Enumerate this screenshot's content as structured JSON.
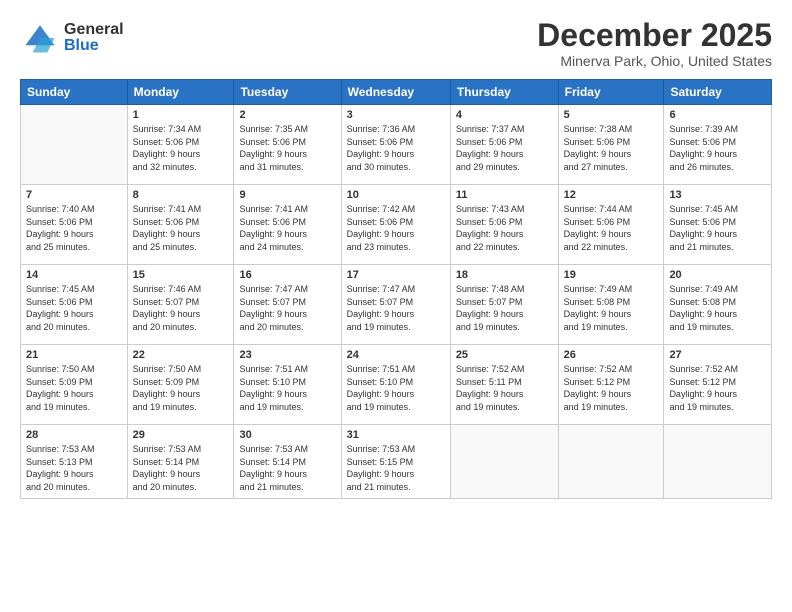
{
  "header": {
    "logo_general": "General",
    "logo_blue": "Blue",
    "month_title": "December 2025",
    "location": "Minerva Park, Ohio, United States"
  },
  "calendar": {
    "days_header": [
      "Sunday",
      "Monday",
      "Tuesday",
      "Wednesday",
      "Thursday",
      "Friday",
      "Saturday"
    ],
    "weeks": [
      [
        {
          "num": "",
          "info": ""
        },
        {
          "num": "1",
          "info": "Sunrise: 7:34 AM\nSunset: 5:06 PM\nDaylight: 9 hours\nand 32 minutes."
        },
        {
          "num": "2",
          "info": "Sunrise: 7:35 AM\nSunset: 5:06 PM\nDaylight: 9 hours\nand 31 minutes."
        },
        {
          "num": "3",
          "info": "Sunrise: 7:36 AM\nSunset: 5:06 PM\nDaylight: 9 hours\nand 30 minutes."
        },
        {
          "num": "4",
          "info": "Sunrise: 7:37 AM\nSunset: 5:06 PM\nDaylight: 9 hours\nand 29 minutes."
        },
        {
          "num": "5",
          "info": "Sunrise: 7:38 AM\nSunset: 5:06 PM\nDaylight: 9 hours\nand 27 minutes."
        },
        {
          "num": "6",
          "info": "Sunrise: 7:39 AM\nSunset: 5:06 PM\nDaylight: 9 hours\nand 26 minutes."
        }
      ],
      [
        {
          "num": "7",
          "info": "Sunrise: 7:40 AM\nSunset: 5:06 PM\nDaylight: 9 hours\nand 25 minutes."
        },
        {
          "num": "8",
          "info": "Sunrise: 7:41 AM\nSunset: 5:06 PM\nDaylight: 9 hours\nand 25 minutes."
        },
        {
          "num": "9",
          "info": "Sunrise: 7:41 AM\nSunset: 5:06 PM\nDaylight: 9 hours\nand 24 minutes."
        },
        {
          "num": "10",
          "info": "Sunrise: 7:42 AM\nSunset: 5:06 PM\nDaylight: 9 hours\nand 23 minutes."
        },
        {
          "num": "11",
          "info": "Sunrise: 7:43 AM\nSunset: 5:06 PM\nDaylight: 9 hours\nand 22 minutes."
        },
        {
          "num": "12",
          "info": "Sunrise: 7:44 AM\nSunset: 5:06 PM\nDaylight: 9 hours\nand 22 minutes."
        },
        {
          "num": "13",
          "info": "Sunrise: 7:45 AM\nSunset: 5:06 PM\nDaylight: 9 hours\nand 21 minutes."
        }
      ],
      [
        {
          "num": "14",
          "info": "Sunrise: 7:45 AM\nSunset: 5:06 PM\nDaylight: 9 hours\nand 20 minutes."
        },
        {
          "num": "15",
          "info": "Sunrise: 7:46 AM\nSunset: 5:07 PM\nDaylight: 9 hours\nand 20 minutes."
        },
        {
          "num": "16",
          "info": "Sunrise: 7:47 AM\nSunset: 5:07 PM\nDaylight: 9 hours\nand 20 minutes."
        },
        {
          "num": "17",
          "info": "Sunrise: 7:47 AM\nSunset: 5:07 PM\nDaylight: 9 hours\nand 19 minutes."
        },
        {
          "num": "18",
          "info": "Sunrise: 7:48 AM\nSunset: 5:07 PM\nDaylight: 9 hours\nand 19 minutes."
        },
        {
          "num": "19",
          "info": "Sunrise: 7:49 AM\nSunset: 5:08 PM\nDaylight: 9 hours\nand 19 minutes."
        },
        {
          "num": "20",
          "info": "Sunrise: 7:49 AM\nSunset: 5:08 PM\nDaylight: 9 hours\nand 19 minutes."
        }
      ],
      [
        {
          "num": "21",
          "info": "Sunrise: 7:50 AM\nSunset: 5:09 PM\nDaylight: 9 hours\nand 19 minutes."
        },
        {
          "num": "22",
          "info": "Sunrise: 7:50 AM\nSunset: 5:09 PM\nDaylight: 9 hours\nand 19 minutes."
        },
        {
          "num": "23",
          "info": "Sunrise: 7:51 AM\nSunset: 5:10 PM\nDaylight: 9 hours\nand 19 minutes."
        },
        {
          "num": "24",
          "info": "Sunrise: 7:51 AM\nSunset: 5:10 PM\nDaylight: 9 hours\nand 19 minutes."
        },
        {
          "num": "25",
          "info": "Sunrise: 7:52 AM\nSunset: 5:11 PM\nDaylight: 9 hours\nand 19 minutes."
        },
        {
          "num": "26",
          "info": "Sunrise: 7:52 AM\nSunset: 5:12 PM\nDaylight: 9 hours\nand 19 minutes."
        },
        {
          "num": "27",
          "info": "Sunrise: 7:52 AM\nSunset: 5:12 PM\nDaylight: 9 hours\nand 19 minutes."
        }
      ],
      [
        {
          "num": "28",
          "info": "Sunrise: 7:53 AM\nSunset: 5:13 PM\nDaylight: 9 hours\nand 20 minutes."
        },
        {
          "num": "29",
          "info": "Sunrise: 7:53 AM\nSunset: 5:14 PM\nDaylight: 9 hours\nand 20 minutes."
        },
        {
          "num": "30",
          "info": "Sunrise: 7:53 AM\nSunset: 5:14 PM\nDaylight: 9 hours\nand 21 minutes."
        },
        {
          "num": "31",
          "info": "Sunrise: 7:53 AM\nSunset: 5:15 PM\nDaylight: 9 hours\nand 21 minutes."
        },
        {
          "num": "",
          "info": ""
        },
        {
          "num": "",
          "info": ""
        },
        {
          "num": "",
          "info": ""
        }
      ]
    ]
  }
}
